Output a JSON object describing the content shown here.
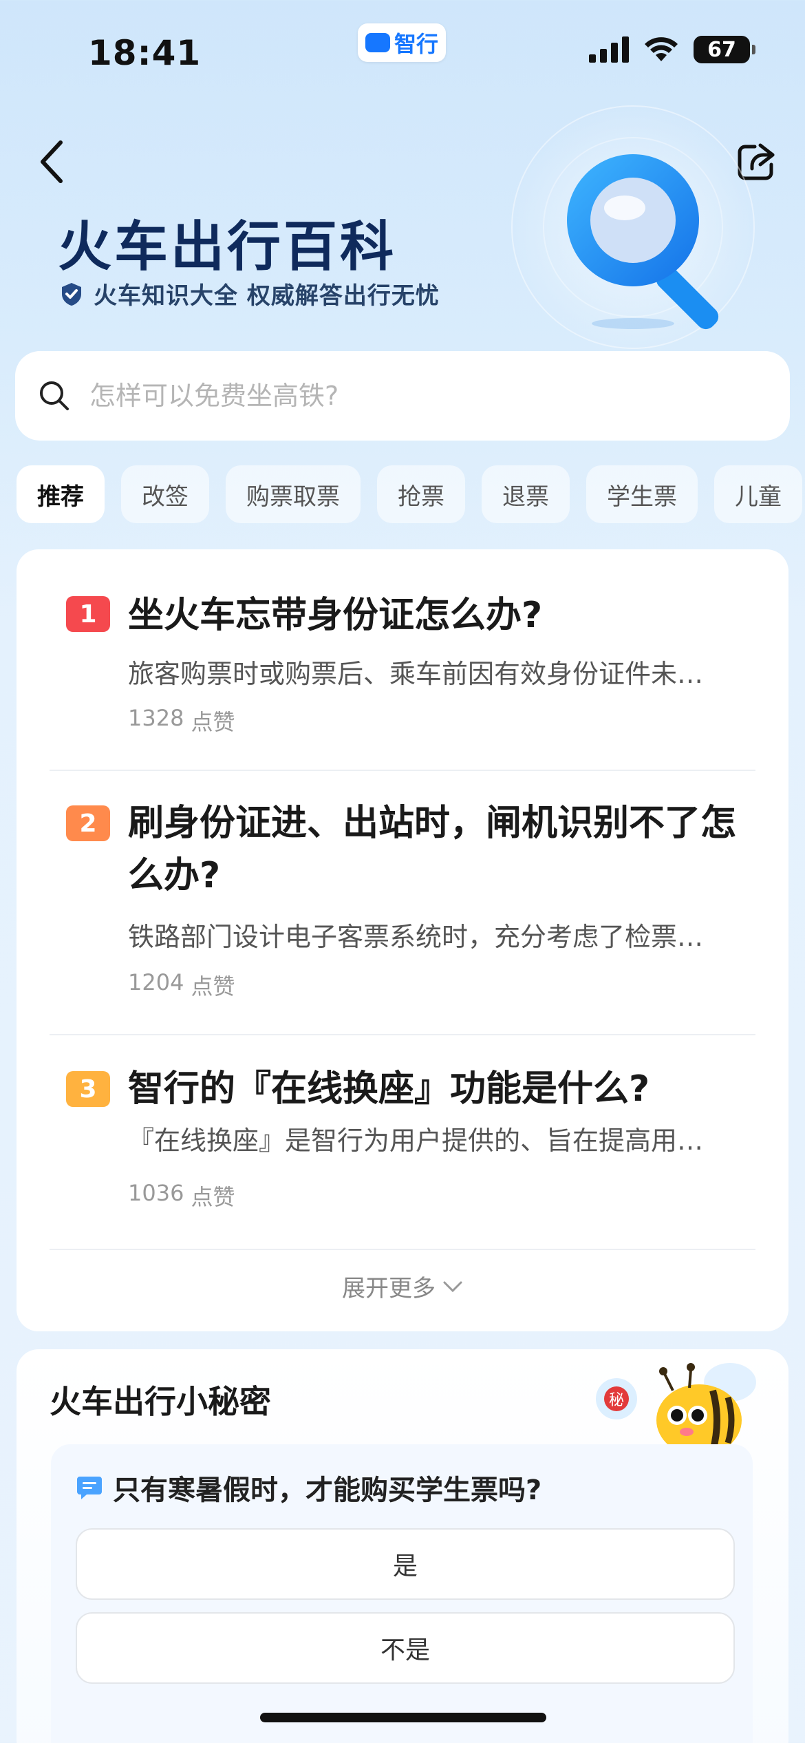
{
  "status_bar": {
    "time": "18:41",
    "app_pill": "智行",
    "battery": "67"
  },
  "header": {
    "title": "火车出行百科",
    "subtitle": "火车知识大全 权威解答出行无忧"
  },
  "search": {
    "placeholder": "怎样可以免费坐高铁?"
  },
  "tabs": [
    "推荐",
    "改签",
    "购票取票",
    "抢票",
    "退票",
    "学生票",
    "儿童"
  ],
  "questions": [
    {
      "rank": "1",
      "rank_color": "#f5494e",
      "title": "坐火车忘带身份证怎么办?",
      "desc": "旅客购票时或购票后、乘车前因有效身份证件未…",
      "likes": "1328",
      "likes_unit": "点赞"
    },
    {
      "rank": "2",
      "rank_color": "#ff8a4c",
      "title": "刷身份证进、出站时，闸机识别不了怎么办?",
      "desc": "铁路部门设计电子客票系统时，充分考虑了检票…",
      "likes": "1204",
      "likes_unit": "点赞"
    },
    {
      "rank": "3",
      "rank_color": "#ffb23f",
      "title": "智行的『在线换座』功能是什么?",
      "desc": "『在线换座』是智行为用户提供的、旨在提高用…",
      "likes": "1036",
      "likes_unit": "点赞"
    }
  ],
  "more_label": "展开更多",
  "secret": {
    "title": "火车出行小秘密",
    "badge": "秘",
    "question": "只有寒暑假时，才能购买学生票吗?",
    "options": [
      "是",
      "不是"
    ]
  },
  "colors": {
    "accent": "#1677ff",
    "title": "#0f2a5c"
  }
}
